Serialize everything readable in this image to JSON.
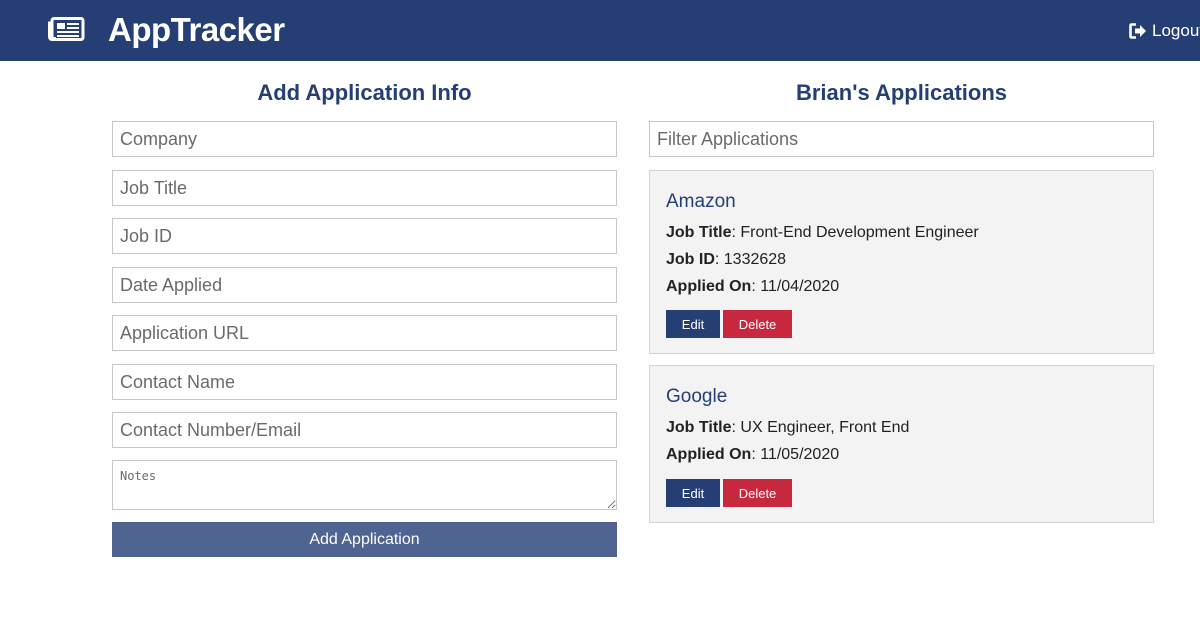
{
  "header": {
    "icon": "newspaper-icon",
    "title": "AppTracker",
    "logout_icon": "sign-out-icon",
    "logout_label": "Logout"
  },
  "form": {
    "title": "Add Application Info",
    "fields": {
      "company": "Company",
      "job_title": "Job Title",
      "job_id": "Job ID",
      "date_applied": "Date Applied",
      "application_url": "Application URL",
      "contact_name": "Contact Name",
      "contact_info": "Contact Number/Email",
      "notes": "Notes"
    },
    "submit_label": "Add Application"
  },
  "list": {
    "title": "Brian's Applications",
    "filter_placeholder": "Filter Applications",
    "applications": [
      {
        "company": "Amazon",
        "job_title_label": "Job Title",
        "job_title": ": Front-End Development Engineer",
        "job_id_label": "Job ID",
        "job_id": ": 1332628",
        "applied_label": "Applied On",
        "applied_on": ": 11/04/2020",
        "edit_label": "Edit",
        "delete_label": "Delete"
      },
      {
        "company": "Google",
        "job_title_label": "Job Title",
        "job_title": ": UX Engineer, Front End",
        "applied_label": "Applied On",
        "applied_on": ": 11/05/2020",
        "edit_label": "Edit",
        "delete_label": "Delete"
      }
    ]
  },
  "colors": {
    "navbar": "#253f75",
    "accent": "#253f75",
    "add_button": "#4f6491",
    "delete_button": "#c8283d",
    "card_background": "#f3f3f3"
  }
}
